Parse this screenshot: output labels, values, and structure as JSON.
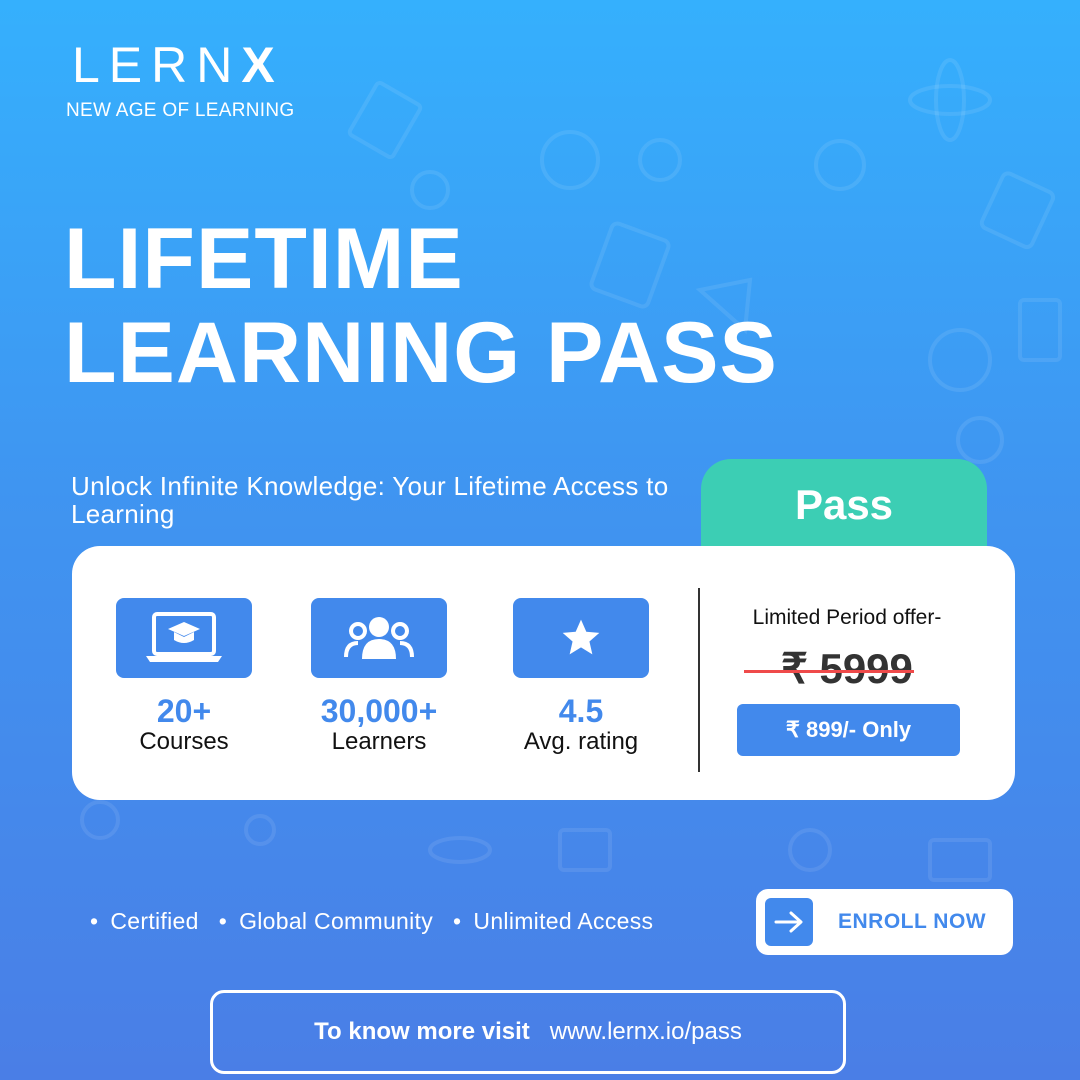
{
  "brand": {
    "logo_main": "LERN",
    "logo_x": "X",
    "tagline": "NEW AGE OF LEARNING"
  },
  "headline": {
    "line1": "LIFETIME",
    "line2": "LEARNING PASS"
  },
  "subtitle": "Unlock Infinite Knowledge: Your Lifetime Access to Learning",
  "pass_tab": "Pass",
  "stats": [
    {
      "icon": "laptop-graduation-icon",
      "value": "20+",
      "label": "Courses"
    },
    {
      "icon": "users-icon",
      "value": "30,000+",
      "label": "Learners"
    },
    {
      "icon": "star-icon",
      "value": "4.5",
      "label": "Avg. rating"
    }
  ],
  "pricing": {
    "offer_label": "Limited Period offer-",
    "old_price": "₹ 5999",
    "new_price": "₹ 899/- Only"
  },
  "features": [
    "Certified",
    "Global Community",
    "Unlimited Access"
  ],
  "enroll": {
    "label": "ENROLL NOW",
    "icon": "arrow-right-icon"
  },
  "visit": {
    "label": "To know more visit",
    "url": "www.lernx.io/pass"
  },
  "colors": {
    "accent": "#4289ec",
    "teal": "#3cceb4",
    "strike": "#ef4a4a"
  }
}
